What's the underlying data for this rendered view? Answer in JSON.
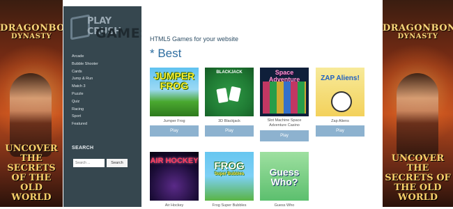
{
  "banners": {
    "left": {
      "logo_line1": "DRAGONBONE",
      "logo_line2": "DYNASTY",
      "tagline": "UNCOVER THE SECRETS OF THE OLD WORLD"
    },
    "right": {
      "logo_line1": "DRAGONBONE",
      "logo_line2": "DYNASTY",
      "tagline": "UNCOVER THE SECRETS OF THE OLD WORLD"
    }
  },
  "site": {
    "logo_line1": "PLAY CRUSH",
    "logo_line2": "GAMES"
  },
  "nav": {
    "items": [
      "Arcade",
      "Bubble Shooter",
      "Cards",
      "Jump & Run",
      "Match 3",
      "Puzzle",
      "Quiz",
      "Racing",
      "Sport",
      "Featured"
    ]
  },
  "search": {
    "title": "SEARCH",
    "placeholder": "Search ...",
    "button": "Search"
  },
  "main": {
    "subtitle": "HTML5 Games for your website",
    "heading": "* Best"
  },
  "games": [
    {
      "name": "Jumper Frog",
      "thumb_text": "JUMPER FROG",
      "play": "Play"
    },
    {
      "name": "3D Blackjack",
      "thumb_text": "BLACKJACK",
      "play": "Play"
    },
    {
      "name": "Slot Machine Space Adventure Casino",
      "thumb_text": "Space Adventure",
      "play": "Play"
    },
    {
      "name": "Zap Aliens",
      "thumb_text": "ZAP Aliens!",
      "play": "Play"
    },
    {
      "name": "Air Hockey",
      "thumb_text": "AIR HOCKEY"
    },
    {
      "name": "Frog Super Bubbles",
      "thumb_text": "FROG",
      "thumb_subtext": "Super Bubbles"
    },
    {
      "name": "Guess Who",
      "thumb_text": "Guess Who?"
    }
  ]
}
